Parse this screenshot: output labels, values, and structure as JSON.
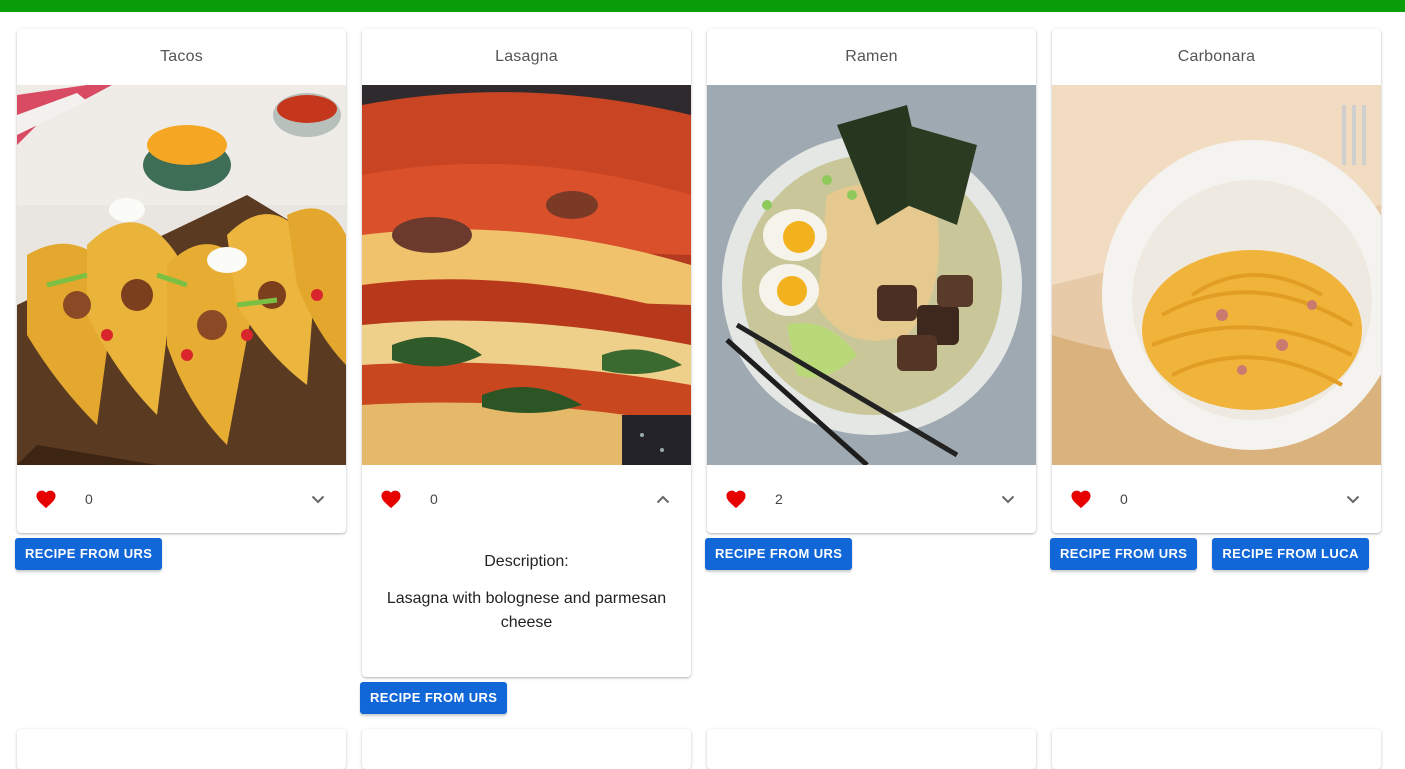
{
  "colors": {
    "accent_bar": "#0a9e0a",
    "button": "#1167d8",
    "heart": "#e60000"
  },
  "cards": [
    {
      "title": "Tacos",
      "likes": "0",
      "expanded": false,
      "image": "tacos-photo",
      "buttons": [
        "RECIPE FROM URS"
      ]
    },
    {
      "title": "Lasagna",
      "likes": "0",
      "expanded": true,
      "image": "lasagna-photo",
      "description_heading": "Description:",
      "description": "Lasagna with bolognese and parmesan cheese",
      "buttons": [
        "RECIPE FROM URS"
      ]
    },
    {
      "title": "Ramen",
      "likes": "2",
      "expanded": false,
      "image": "ramen-photo",
      "buttons": [
        "RECIPE FROM URS"
      ]
    },
    {
      "title": "Carbonara",
      "likes": "0",
      "expanded": false,
      "image": "carbonara-photo",
      "buttons": [
        "RECIPE FROM URS",
        "RECIPE FROM LUCA"
      ]
    }
  ],
  "icons": {
    "like": "heart-icon",
    "expand": "chevron-down-icon",
    "collapse": "chevron-up-icon"
  }
}
